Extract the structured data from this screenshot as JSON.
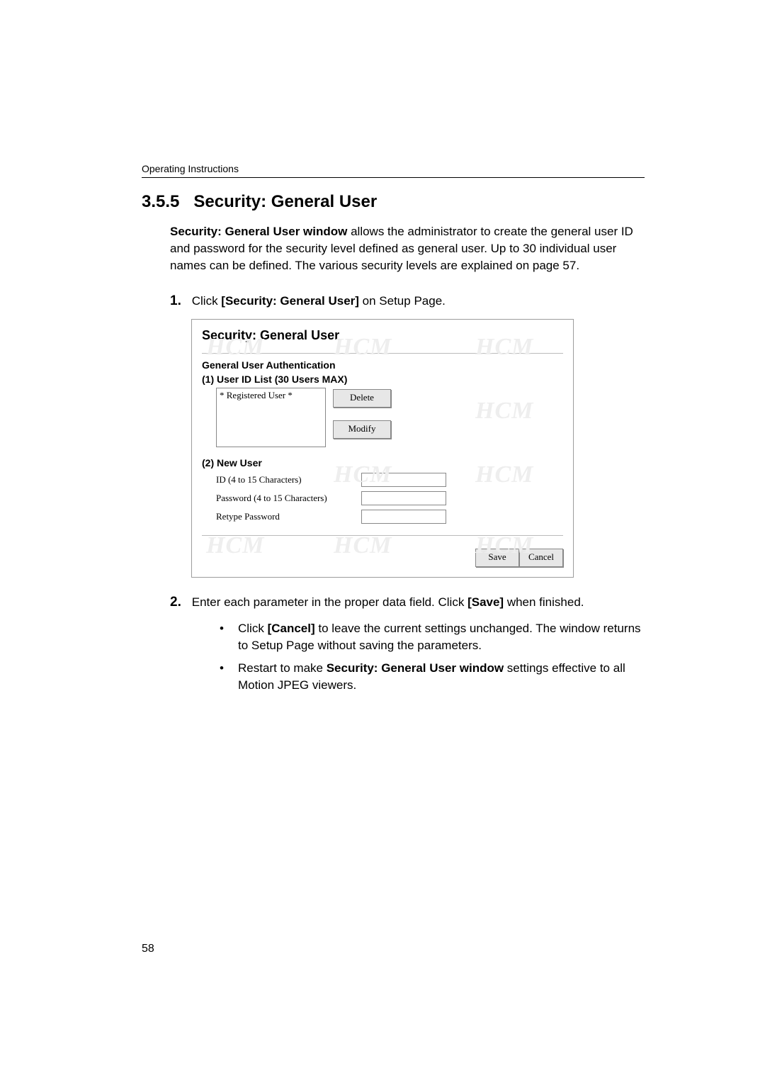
{
  "header": "Operating Instructions",
  "section_num": "3.5.5",
  "section_title": "Security: General User",
  "intro_bold": "Security: General User window",
  "intro_rest": " allows the administrator to create the general user ID and password for the security level defined as general user. Up to 30 individual user names can be defined. The various security levels are explained on page 57.",
  "step1_num": "1.",
  "step1_a": "Click ",
  "step1_bold": "[Security: General User]",
  "step1_b": " on Setup Page.",
  "figure": {
    "title": "Security: General User",
    "subhead": "General User Authentication",
    "list_label": "(1)  User ID List (30 Users MAX)",
    "list_item": "* Registered User *",
    "btn_delete": "Delete",
    "btn_modify": "Modify",
    "new_label": "(2)  New User",
    "id_label": "ID (4 to 15 Characters)",
    "pw_label": "Password (4 to 15 Characters)",
    "rpw_label": "Retype Password",
    "btn_save": "Save",
    "btn_cancel": "Cancel"
  },
  "step2_num": "2.",
  "step2_a": "Enter each parameter in the proper data field. Click ",
  "step2_bold": "[Save]",
  "step2_b": " when finished.",
  "bullet1_a": "Click ",
  "bullet1_bold": "[Cancel]",
  "bullet1_b": " to leave the current settings unchanged. The window returns to Setup Page without saving the parameters.",
  "bullet2_a": "Restart to make ",
  "bullet2_bold": "Security: General User window",
  "bullet2_b": " settings effective to all Motion JPEG viewers.",
  "page_number": "58"
}
